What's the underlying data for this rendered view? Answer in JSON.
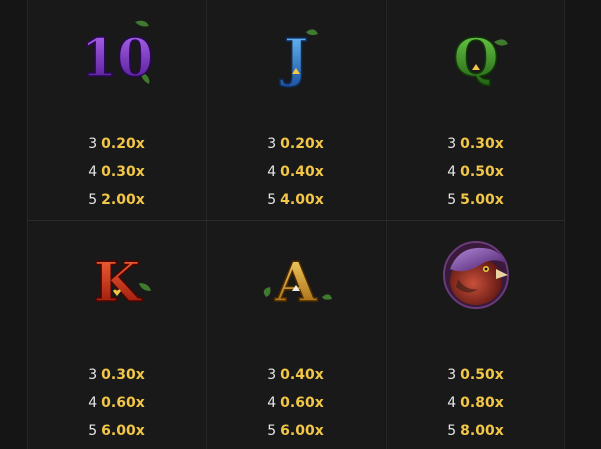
{
  "paytable": [
    {
      "symbol": "10",
      "icon": "ten-card-symbol-icon",
      "color": "#7b35c9",
      "pays": [
        {
          "count": "3",
          "multiplier": "0.20x"
        },
        {
          "count": "4",
          "multiplier": "0.30x"
        },
        {
          "count": "5",
          "multiplier": "2.00x"
        }
      ]
    },
    {
      "symbol": "J",
      "icon": "jack-card-symbol-icon",
      "color": "#3a8fd6",
      "pays": [
        {
          "count": "3",
          "multiplier": "0.20x"
        },
        {
          "count": "4",
          "multiplier": "0.40x"
        },
        {
          "count": "5",
          "multiplier": "4.00x"
        }
      ]
    },
    {
      "symbol": "Q",
      "icon": "queen-card-symbol-icon",
      "color": "#3c9a2a",
      "pays": [
        {
          "count": "3",
          "multiplier": "0.30x"
        },
        {
          "count": "4",
          "multiplier": "0.50x"
        },
        {
          "count": "5",
          "multiplier": "5.00x"
        }
      ]
    },
    {
      "symbol": "K",
      "icon": "king-card-symbol-icon",
      "color": "#d62a10",
      "pays": [
        {
          "count": "3",
          "multiplier": "0.30x"
        },
        {
          "count": "4",
          "multiplier": "0.60x"
        },
        {
          "count": "5",
          "multiplier": "6.00x"
        }
      ]
    },
    {
      "symbol": "A",
      "icon": "ace-card-symbol-icon",
      "color": "#d9a21a",
      "pays": [
        {
          "count": "3",
          "multiplier": "0.40x"
        },
        {
          "count": "4",
          "multiplier": "0.60x"
        },
        {
          "count": "5",
          "multiplier": "6.00x"
        }
      ]
    },
    {
      "icon": "pheasant-bird-symbol-icon",
      "color": "#8a3a9a",
      "pays": [
        {
          "count": "3",
          "multiplier": "0.50x"
        },
        {
          "count": "4",
          "multiplier": "0.80x"
        },
        {
          "count": "5",
          "multiplier": "8.00x"
        }
      ]
    }
  ],
  "colors": {
    "background": "#151515",
    "cell": "#191919",
    "count_text": "#e6e6e6",
    "multiplier_text": "#f2c646"
  }
}
